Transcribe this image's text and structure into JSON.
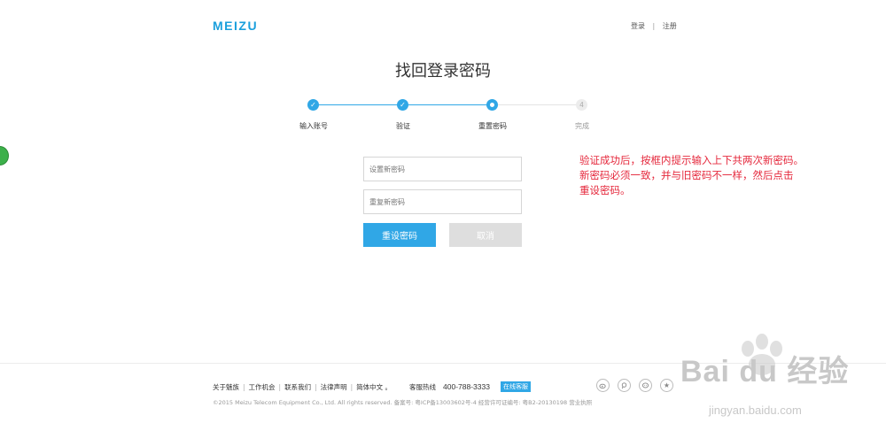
{
  "header": {
    "logo": "MEIZU",
    "login": "登录",
    "separator": "|",
    "register": "注册"
  },
  "page_title": "找回登录密码",
  "steps": [
    {
      "number": "1",
      "label": "输入账号",
      "state": "done"
    },
    {
      "number": "2",
      "label": "验证",
      "state": "done"
    },
    {
      "number": "3",
      "label": "重置密码",
      "state": "current"
    },
    {
      "number": "4",
      "label": "完成",
      "state": "todo"
    }
  ],
  "form": {
    "new_password_placeholder": "设置新密码",
    "repeat_password_placeholder": "重复新密码",
    "reset_button": "重设密码",
    "cancel_button": "取消"
  },
  "annotation": {
    "line1": "验证成功后，按框内提示输入上下共两次新密码。",
    "line2": "新密码必须一致，并与旧密码不一样，然后点击",
    "line3": "重设密码。"
  },
  "footer": {
    "links": [
      "关于魅族",
      "工作机会",
      "联系我们",
      "法律声明",
      "简体中文 。"
    ],
    "hotline_label": "客服热线",
    "hotline_number": "400-788-3333",
    "online_service": "在线客服",
    "copyright": "©2015 Meizu Telecom Equipment Co., Ltd. All rights reserved.  备案号: 粤ICP备13003602号-4  经营许可证编号: 粤B2-20130198  营业执照",
    "social_icons": [
      "weibo-icon",
      "tencent-weibo-icon",
      "wechat-icon",
      "star-icon"
    ]
  },
  "watermark": {
    "brand": "Bai du 经验",
    "url": "jingyan.baidu.com"
  },
  "colors": {
    "accent": "#30a7e6",
    "logo": "#1a9fdc",
    "annotation": "#e5283c",
    "disabled_button": "#dedede"
  }
}
